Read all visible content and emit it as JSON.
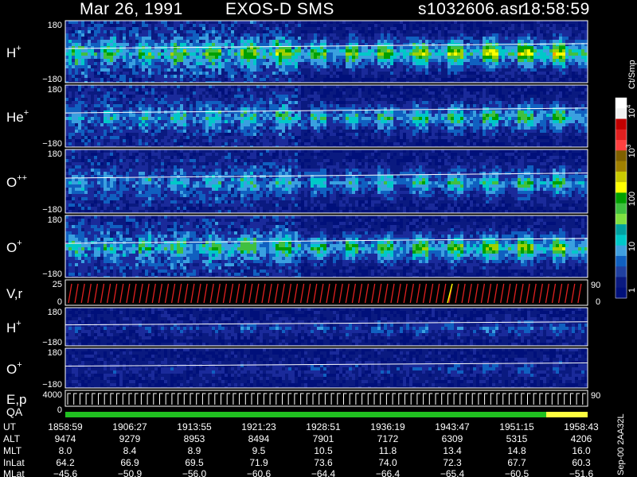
{
  "header": {
    "date": "Mar 26, 1991",
    "mission": "EXOS-D SMS",
    "file": "s1032606.asr",
    "time": "18:58:59"
  },
  "colorbar": {
    "unit": "Ct/Smp",
    "tick_labels": [
      "10^4",
      "10^3",
      "100",
      "10",
      "1"
    ],
    "colors": [
      "#ffffff",
      "#f0f0f0",
      "#c00000",
      "#e02020",
      "#ff4040",
      "#806000",
      "#a08000",
      "#c8c800",
      "#ffff00",
      "#00a000",
      "#40c040",
      "#80e040",
      "#00a0a0",
      "#00c8c8",
      "#40a0e0",
      "#1060c0",
      "#2040a0",
      "#0a1a80",
      "#00107a"
    ]
  },
  "panels": [
    {
      "label": "H",
      "sup": "+",
      "ytop": "180",
      "ybot": "−180",
      "activity": 0.85
    },
    {
      "label": "He",
      "sup": "+",
      "ytop": "180",
      "ybot": "−180",
      "activity": 0.6
    },
    {
      "label": "O",
      "sup": "++",
      "ytop": "180",
      "ybot": "−180",
      "activity": 0.55
    },
    {
      "label": "O",
      "sup": "+",
      "ytop": "180",
      "ybot": "−180",
      "activity": 0.75
    },
    {
      "label": "V,r",
      "sup": "",
      "ytop": "25",
      "ybot": "0",
      "right_top": "90",
      "right_bot": "0",
      "kind": "vr"
    },
    {
      "label": "H",
      "sup": "+",
      "ytop": "180",
      "ybot": "−180",
      "activity": 0.3
    },
    {
      "label": "O",
      "sup": "+",
      "ytop": "180",
      "ybot": "−180",
      "activity": 0.2
    },
    {
      "label": "E,p",
      "sup": "",
      "ytop": "4000",
      "ybot": "",
      "right_top": "90",
      "kind": "ep"
    }
  ],
  "qa": {
    "label": "QA",
    "value": "0"
  },
  "footer": {
    "row_labels": [
      "UT",
      "ALT",
      "MLT",
      "InLat",
      "MLat"
    ],
    "columns": [
      {
        "UT": "1858:59",
        "ALT": "9474",
        "MLT": "8.0",
        "InLat": "64.2",
        "MLat": "−45.6"
      },
      {
        "UT": "1906:27",
        "ALT": "9279",
        "MLT": "8.4",
        "InLat": "66.9",
        "MLat": "−50.9"
      },
      {
        "UT": "1913:55",
        "ALT": "8953",
        "MLT": "8.9",
        "InLat": "69.5",
        "MLat": "−56.0"
      },
      {
        "UT": "1921:23",
        "ALT": "8494",
        "MLT": "9.5",
        "InLat": "71.9",
        "MLat": "−60.6"
      },
      {
        "UT": "1928:51",
        "ALT": "7901",
        "MLT": "10.5",
        "InLat": "73.6",
        "MLat": "−64.4"
      },
      {
        "UT": "1936:19",
        "ALT": "7172",
        "MLT": "11.8",
        "InLat": "74.0",
        "MLat": "−66.4"
      },
      {
        "UT": "1943:47",
        "ALT": "6309",
        "MLT": "13.4",
        "InLat": "72.3",
        "MLat": "−65.4"
      },
      {
        "UT": "1951:15",
        "ALT": "5315",
        "MLT": "14.8",
        "InLat": "67.7",
        "MLat": "−60.5"
      },
      {
        "UT": "1958:43",
        "ALT": "4206",
        "MLT": "16.0",
        "InLat": "60.3",
        "MLat": "−51.6"
      }
    ],
    "stamp": "Sep-00 2AA32L"
  },
  "chart_data": {
    "type": "heatmap",
    "title": "Mar 26, 1991   EXOS-D SMS",
    "x": [
      "1858:59",
      "1906:27",
      "1913:55",
      "1921:23",
      "1928:51",
      "1936:19",
      "1943:47",
      "1951:15",
      "1958:43"
    ],
    "xlabel": "UT",
    "series": [
      {
        "name": "H+",
        "ylim": [
          -180,
          180
        ]
      },
      {
        "name": "He+",
        "ylim": [
          -180,
          180
        ]
      },
      {
        "name": "O++",
        "ylim": [
          -180,
          180
        ]
      },
      {
        "name": "O+",
        "ylim": [
          -180,
          180
        ]
      },
      {
        "name": "V,r",
        "ylim": [
          0,
          25
        ]
      },
      {
        "name": "H+",
        "ylim": [
          -180,
          180
        ]
      },
      {
        "name": "O+",
        "ylim": [
          -180,
          180
        ]
      },
      {
        "name": "E,p",
        "ylim": [
          0,
          4000
        ]
      }
    ],
    "colorscale": {
      "label": "Ct/Smp",
      "range": [
        1,
        10000
      ],
      "log": true
    },
    "grid": false
  }
}
